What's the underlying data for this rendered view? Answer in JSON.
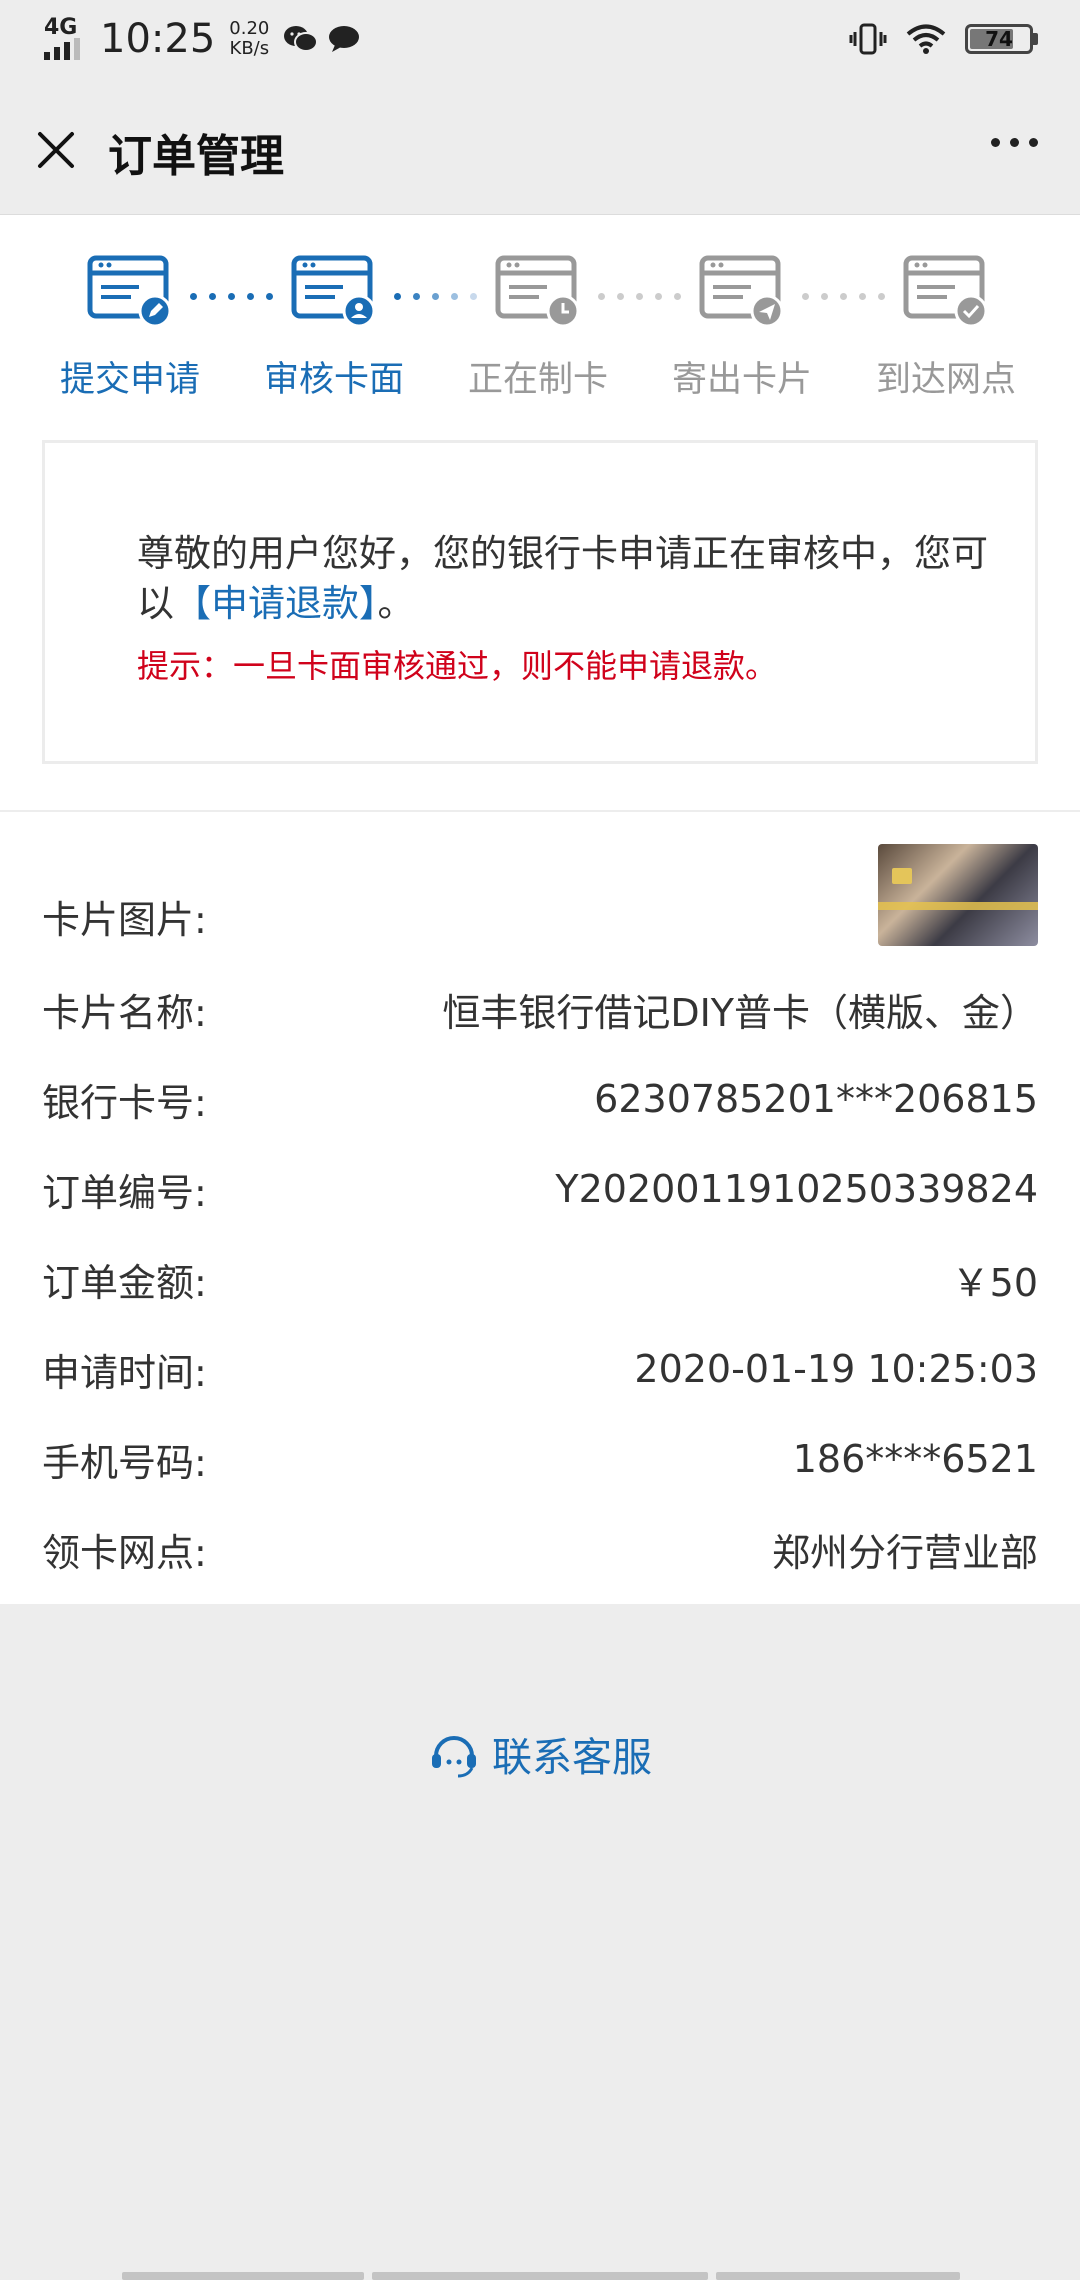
{
  "status_bar": {
    "network": "4G",
    "time": "10:25",
    "speed_value": "0.20",
    "speed_unit": "KB/s",
    "battery": "74",
    "battery_level": 0.74
  },
  "navbar": {
    "title": "订单管理"
  },
  "steps": [
    {
      "label": "提交申请",
      "state": "done"
    },
    {
      "label": "审核卡面",
      "state": "current"
    },
    {
      "label": "正在制卡",
      "state": "pending"
    },
    {
      "label": "寄出卡片",
      "state": "pending"
    },
    {
      "label": "到达网点",
      "state": "pending"
    }
  ],
  "notice": {
    "text_before": "尊敬的用户您好，您的银行卡申请正在审核中，您可以",
    "link": "【申请退款】",
    "text_after": "。",
    "tip": "提示：一旦卡面审核通过，则不能申请退款。"
  },
  "info": {
    "card_image_label": "卡片图片:",
    "card_name_label": "卡片名称:",
    "card_name": "恒丰银行借记DIY普卡（横版、金）",
    "card_number_label": "银行卡号:",
    "card_number": "6230785201***206815",
    "order_no_label": "订单编号:",
    "order_no": "Y2020011910250339824",
    "amount_label": "订单金额:",
    "amount": "￥50",
    "apply_time_label": "申请时间:",
    "apply_time": "2020-01-19 10:25:03",
    "phone_label": "手机号码:",
    "phone": "186****6521",
    "branch_label": "领卡网点:",
    "branch": "郑州分行营业部"
  },
  "contact": {
    "label": "联系客服"
  },
  "colors": {
    "accent": "#1a6db5",
    "pending": "#999999",
    "tip": "#d0021b"
  }
}
